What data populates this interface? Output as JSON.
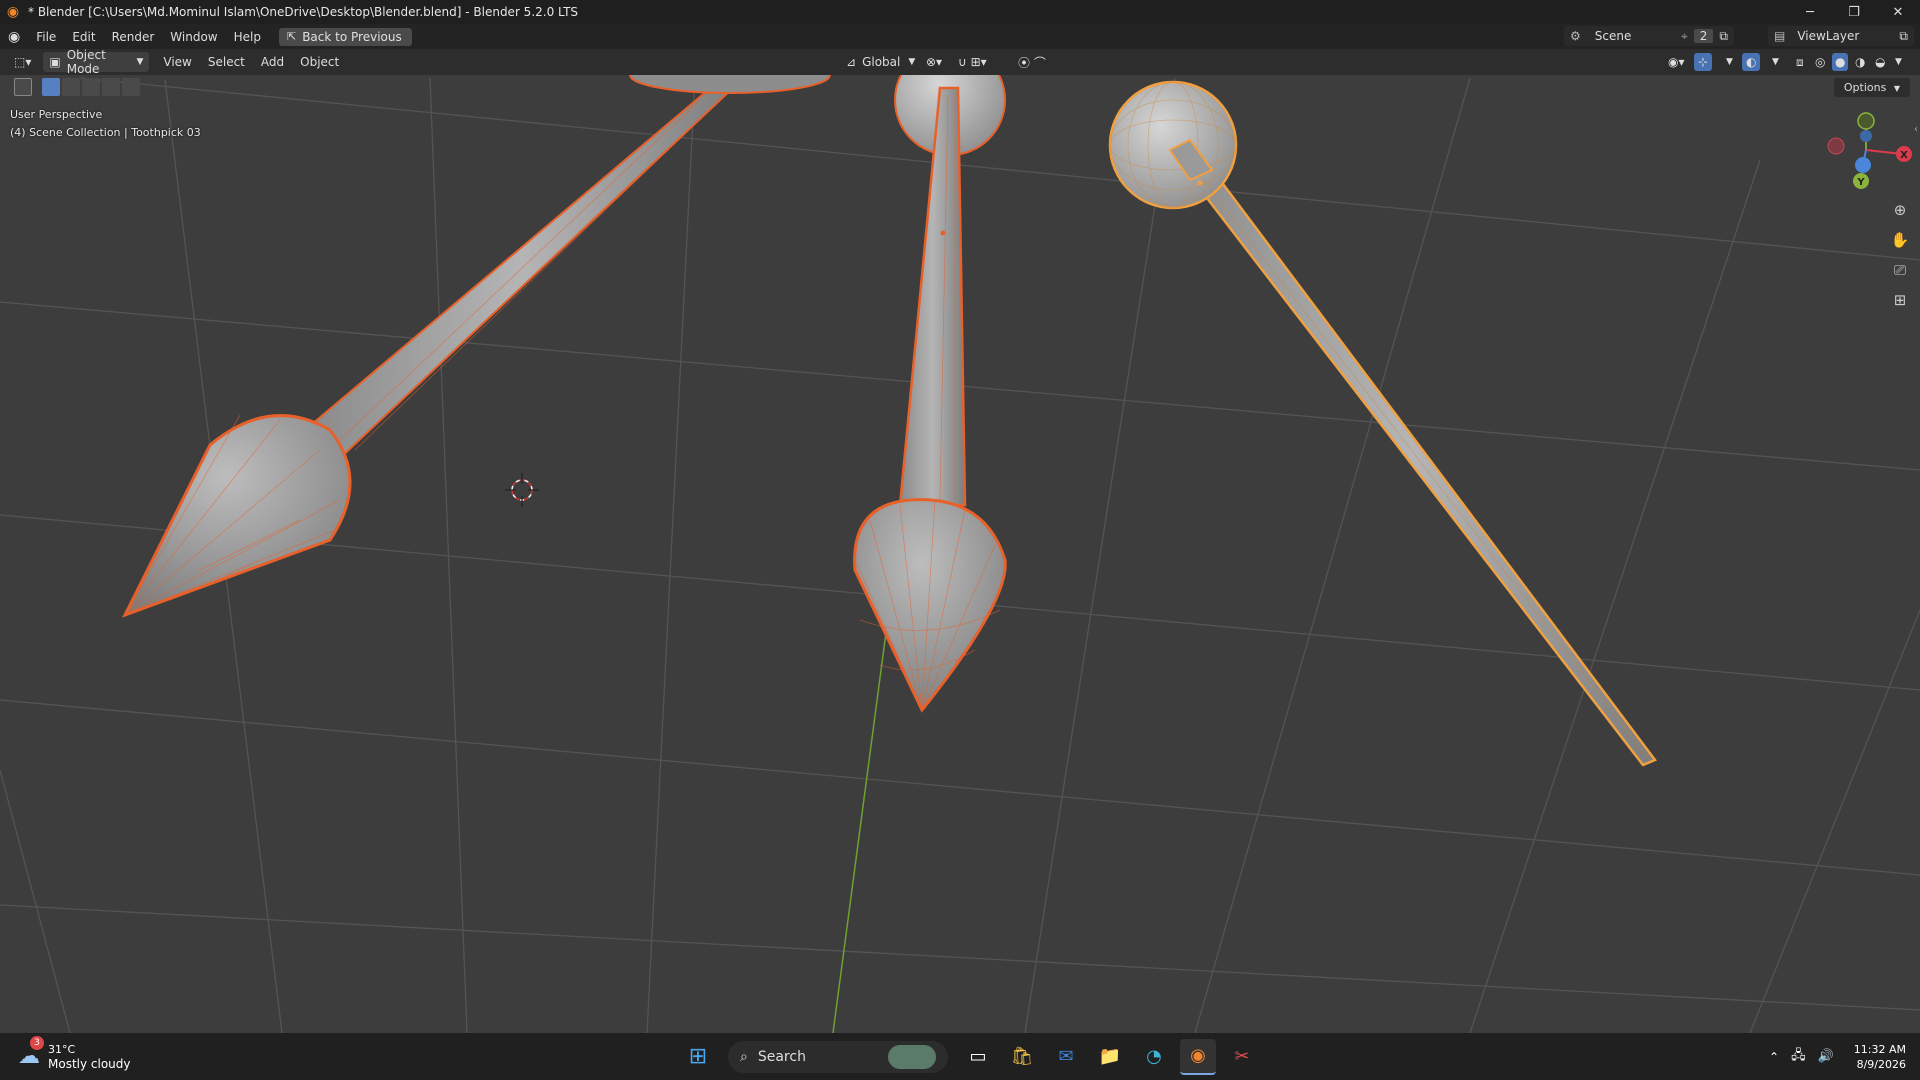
{
  "window": {
    "title": "* Blender [C:\\Users\\Md.Mominul Islam\\OneDrive\\Desktop\\Blender.blend] - Blender 5.2.0 LTS"
  },
  "menu": {
    "items": [
      "File",
      "Edit",
      "Render",
      "Window",
      "Help"
    ],
    "back_label": "Back to Previous"
  },
  "scene": {
    "name": "Scene",
    "count": "2",
    "view_layer": "ViewLayer"
  },
  "viewport_header": {
    "mode": "Object Mode",
    "menus": [
      "View",
      "Select",
      "Add",
      "Object"
    ],
    "orientation": "Global",
    "options_label": "Options"
  },
  "viewport": {
    "perspective": "User Perspective",
    "collection": "(4) Scene Collection | Toothpick 03",
    "gizmo_axes": [
      "X",
      "Y",
      "Z"
    ]
  },
  "taskbar": {
    "weather_badge": "3",
    "temperature": "31°C",
    "condition": "Mostly cloudy",
    "search_placeholder": "Search",
    "time": "11:32 AM",
    "date": "8/9/2026"
  },
  "colors": {
    "accent": "#e8602a",
    "selected_active": "#f0a040",
    "viewport_bg": "#3d3d3d"
  }
}
